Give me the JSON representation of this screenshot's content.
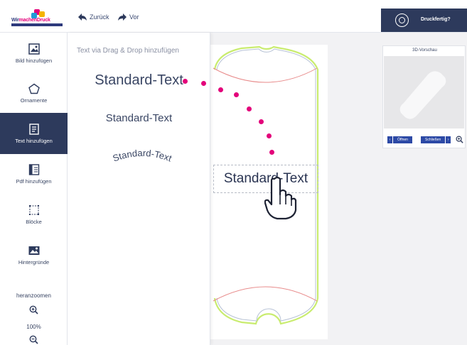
{
  "header": {
    "logo_text_a": "Wir",
    "logo_text_b": "machenDruck",
    "back_label": "Zurück",
    "forward_label": "Vor",
    "print_label": "Druckfertig?"
  },
  "sidebar": {
    "items": [
      {
        "label": "Bild hinzufügen",
        "icon": "image-icon"
      },
      {
        "label": "Ornamente",
        "icon": "pentagon-icon"
      },
      {
        "label": "Text hinzufügen",
        "icon": "text-document-icon",
        "active": true
      },
      {
        "label": "Pdf hinzufügen",
        "icon": "pdf-icon"
      },
      {
        "label": "Blöcke",
        "icon": "blocks-icon"
      },
      {
        "label": "Hintergründe",
        "icon": "background-icon"
      }
    ],
    "zoom_label": "heranzoomen",
    "zoom_value": "100%"
  },
  "text_panel": {
    "title": "Text via Drag & Drop hinzufügen",
    "samples": [
      "Standard-Text",
      "Standard-Text",
      "Standard-Text"
    ]
  },
  "canvas": {
    "dropped_text": "Standard-Text"
  },
  "preview": {
    "title": "3D-Vorschau",
    "open_label": "Öffnen",
    "close_label": "Schließen"
  },
  "colors": {
    "primary": "#2d3a5c",
    "accent": "#e3007a",
    "outline_green": "#c9ec6f",
    "cut_line": "#e88a8a"
  }
}
